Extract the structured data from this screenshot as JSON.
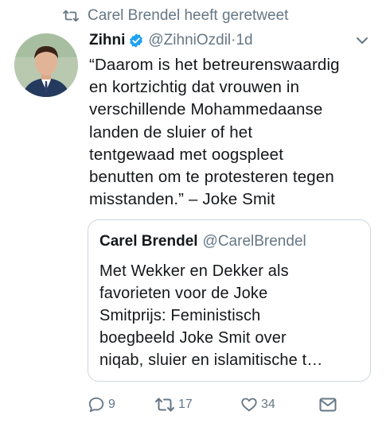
{
  "retweet_context": {
    "text": "Carel Brendel heeft geretweet",
    "icon": "retweet-icon"
  },
  "tweet": {
    "author_name": "Zihni",
    "verified_icon": "verified-badge-icon",
    "handle": "@ZihniOzdil",
    "separator": "·",
    "time": "1d",
    "text": "“Daarom is het betreurenswaardig\nen kortzichtig dat vrouwen in\nverschillende Mohammedaanse\nlanden de sluier of het\ntentgewaad met oogspleet\nbenutten om te protesteren tegen\nmisstanden.” – Joke Smit"
  },
  "quoted_tweet": {
    "author_name": "Carel Brendel",
    "handle": "@CarelBrendel",
    "text": "Met Wekker en Dekker als\nfavorieten voor de Joke\nSmitprijs:  Feministisch\nboegbeeld Joke Smit over\nniqab, sluier en islamitische t…"
  },
  "actions": {
    "replies": "9",
    "retweets": "17",
    "likes": "34"
  },
  "colors": {
    "text": "#14171a",
    "secondary": "#657786",
    "verified": "#1da1f2",
    "border": "#ccd6dd"
  }
}
